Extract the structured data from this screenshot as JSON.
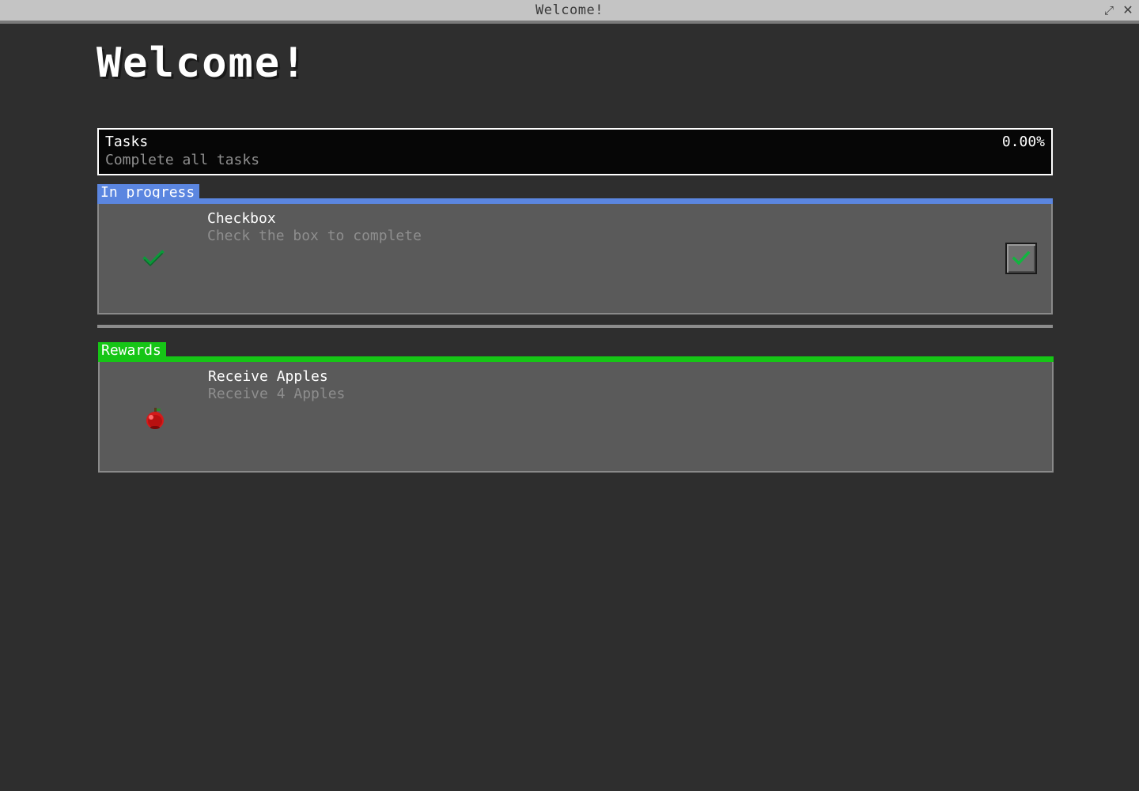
{
  "window": {
    "title": "Welcome!",
    "expand_icon": "expand-icon",
    "close_icon": "close-icon"
  },
  "page": {
    "title": "Welcome!"
  },
  "tasks": {
    "title": "Tasks",
    "subtitle": "Complete all tasks",
    "progress": "0.00%"
  },
  "sections": {
    "in_progress": {
      "label": "In progress",
      "color": "#5b86e0",
      "items": [
        {
          "title": "Checkbox",
          "subtitle": "Check the box to complete",
          "icon": "checkmark-icon",
          "checked": true
        }
      ]
    },
    "rewards": {
      "label": "Rewards",
      "color": "#16c516",
      "items": [
        {
          "title": "Receive Apples",
          "subtitle": "Receive 4 Apples",
          "icon": "apple-icon"
        }
      ]
    }
  }
}
